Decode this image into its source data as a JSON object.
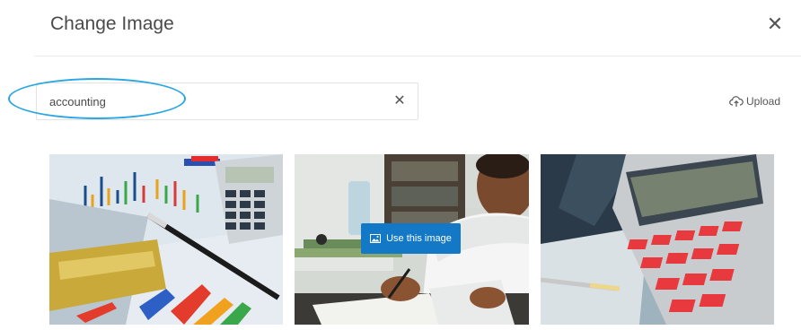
{
  "dialog": {
    "title": "Change Image",
    "close_glyph": "✕"
  },
  "search": {
    "value": "accounting",
    "placeholder": "",
    "clear_glyph": "✕"
  },
  "upload": {
    "label": "Upload",
    "icon": "cloud-upload-icon"
  },
  "images": [
    {
      "subject": "charts-calculator-pen",
      "hover": false
    },
    {
      "subject": "man-working-at-desk",
      "hover": true,
      "hover_label": "Use this image",
      "hover_icon": "images-icon"
    },
    {
      "subject": "red-key-calculator",
      "hover": false
    }
  ],
  "colors": {
    "accent": "#1378c6",
    "highlight_ring": "#2aa6e3",
    "title_text": "#4a4a4a"
  }
}
